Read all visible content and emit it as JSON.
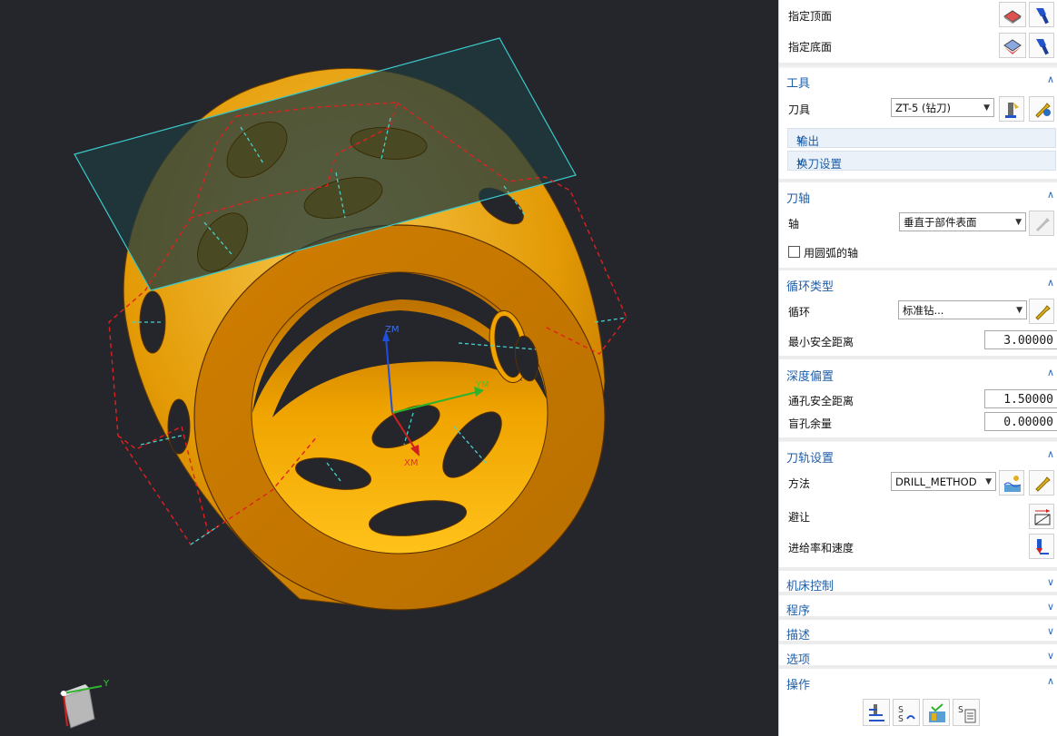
{
  "viewport": {
    "axis_labels": {
      "zm": "ZM",
      "ym": "YM",
      "xm": "XM"
    },
    "triad_label": "Y",
    "colors": {
      "background": "#25262b",
      "part": "#f2a100",
      "plane": "#1f3b40",
      "toolpath": "#e02020",
      "axis_line": "#48d1cc"
    }
  },
  "geometry": {
    "top_face": {
      "label": "指定顶面"
    },
    "bottom_face": {
      "label": "指定底面"
    }
  },
  "tool": {
    "header": "工具",
    "tool_label": "刀具",
    "tool_value": "ZT-5 (钻刀)",
    "output_label": "输出",
    "tool_change_label": "换刀设置"
  },
  "tool_axis": {
    "header": "刀轴",
    "axis_label": "轴",
    "axis_value": "垂直于部件表面",
    "arc_axis_label": "用圆弧的轴"
  },
  "cycle_type": {
    "header": "循环类型",
    "cycle_label": "循环",
    "cycle_value": "标准钻...",
    "min_clearance_label": "最小安全距离",
    "min_clearance_value": "3.00000"
  },
  "depth_offset": {
    "header": "深度偏置",
    "through_clearance_label": "通孔安全距离",
    "through_clearance_value": "1.50000",
    "blind_stock_label": "盲孔余量",
    "blind_stock_value": "0.00000"
  },
  "path_settings": {
    "header": "刀轨设置",
    "method_label": "方法",
    "method_value": "DRILL_METHOD",
    "avoid_label": "避让",
    "feeds_label": "进给率和速度"
  },
  "collapsed": {
    "machine_control": "机床控制",
    "program": "程序",
    "description": "描述",
    "options": "选项",
    "actions": "操作"
  },
  "icons": {
    "expanded": "chevron-up-icon",
    "collapsed": "chevron-down-icon"
  }
}
